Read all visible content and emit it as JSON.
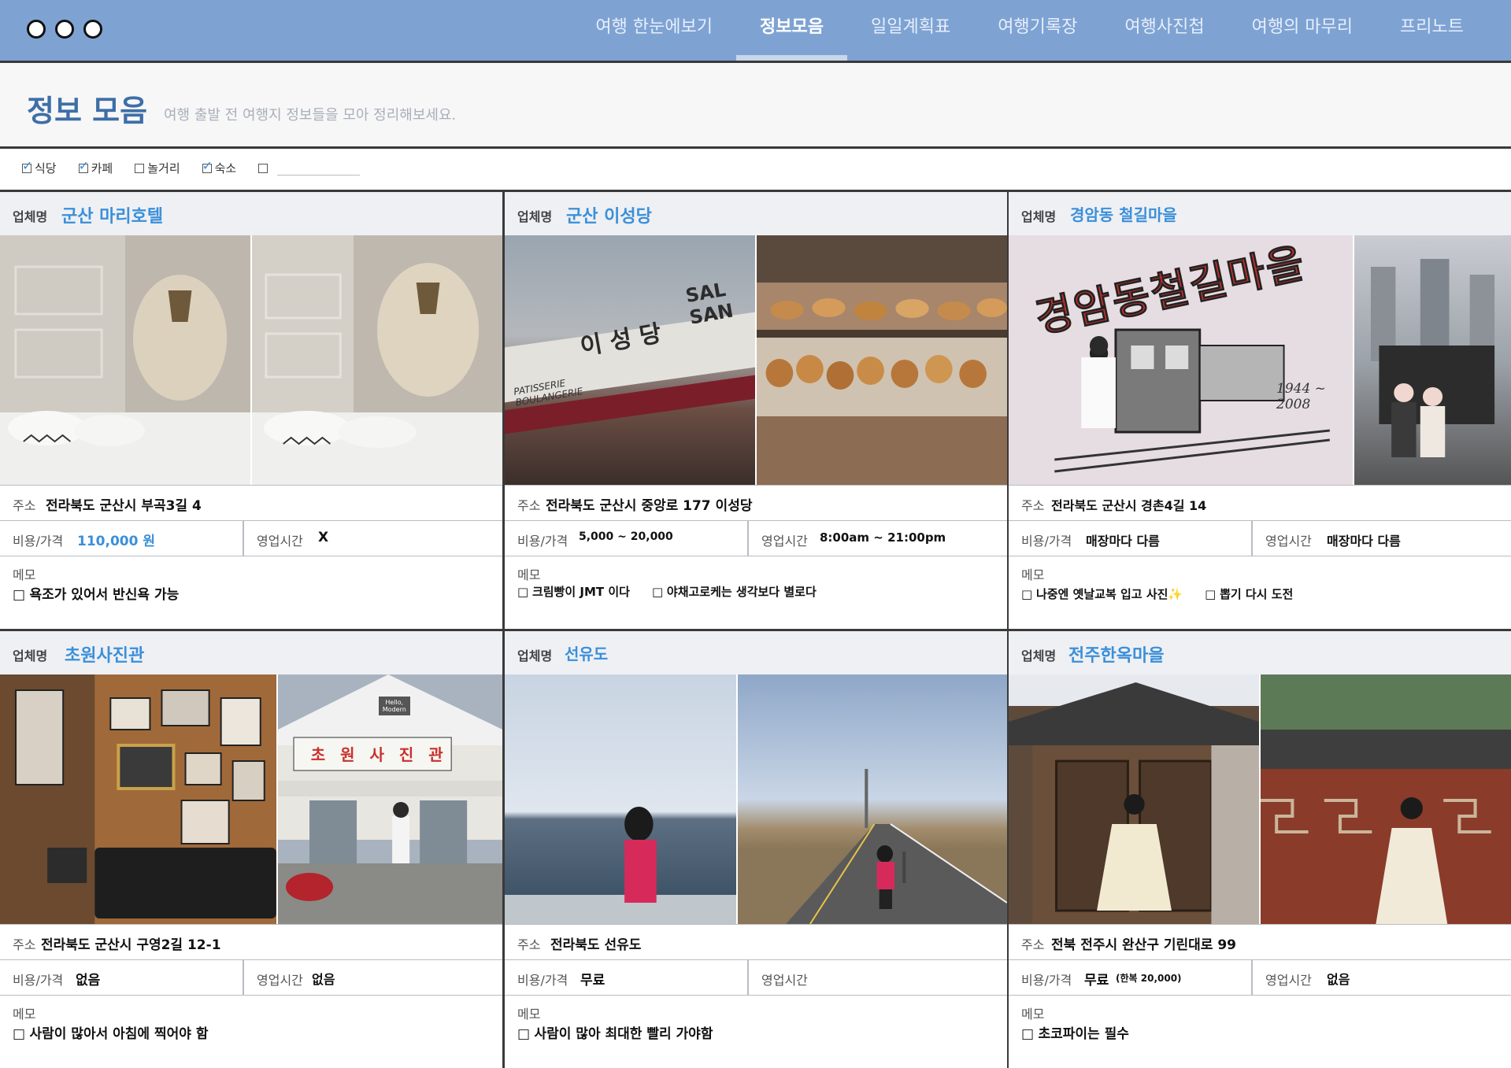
{
  "window": {
    "controls": [
      "circle",
      "circle",
      "circle"
    ]
  },
  "nav": {
    "items": [
      {
        "label": "여행 한눈에보기"
      },
      {
        "label": "정보모음",
        "active": true
      },
      {
        "label": "일일계획표"
      },
      {
        "label": "여행기록장"
      },
      {
        "label": "여행사진첩"
      },
      {
        "label": "여행의 마무리"
      },
      {
        "label": "프리노트"
      }
    ]
  },
  "header": {
    "title": "정보 모음",
    "subtitle": "여행 출발 전 여행지 정보들을 모아 정리해보세요."
  },
  "filters": [
    {
      "label": "식당",
      "checked": true
    },
    {
      "label": "카페",
      "checked": true
    },
    {
      "label": "놀거리",
      "checked": false
    },
    {
      "label": "숙소",
      "checked": true
    },
    {
      "label": "",
      "checked": false
    }
  ],
  "labels": {
    "name": "업체명",
    "address": "주소",
    "cost": "비용/가격",
    "hours": "영업시간",
    "memo": "메모"
  },
  "cards": [
    {
      "name": "군산 마리호텔",
      "address": "전라북도 군산시 부곡3길 4",
      "cost": "110,000 원",
      "cost_highlight": true,
      "hours": "X",
      "memos": [
        "욕조가 있어서 반신욕 가능"
      ]
    },
    {
      "name": "군산 이성당",
      "address": "전라북도 군산시 중앙로 177 이성당",
      "cost": "5,000 ~ 20,000",
      "hours": "8:00am ~ 21:00pm",
      "memos": [
        "크림빵이 JMT 이다",
        "야채고로케는 생각보다 별로다"
      ],
      "photo_text": {
        "sign": "이 성 당",
        "sign2": "SAL SAN",
        "sign3": "PATISSERIE BOULANGERIE"
      }
    },
    {
      "name": "경암동 철길마을",
      "address": "전라북도 군산시 경촌4길 14",
      "cost": "매장마다 다름",
      "hours": "매장마다 다름",
      "memos": [
        "나중엔 옛날교복 입고 사진✨",
        "뽑기 다시 도전"
      ],
      "photo_text": {
        "sign": "경암동철길마을",
        "years": "1944 ~ 2008"
      }
    },
    {
      "name": "초원사진관",
      "address": "전라북도 군산시 구영2길 12-1",
      "cost": "없음",
      "hours": "없음",
      "memos": [
        "사람이 많아서 아침에 찍어야 함"
      ],
      "photo_text": {
        "sign": "초 원 사 진 관",
        "badge": "Hello, Modern"
      }
    },
    {
      "name": "선유도",
      "address": "전라북도 선유도",
      "cost": "무료",
      "hours": "",
      "memos": [
        "사람이 많아 최대한 빨리 가야함"
      ]
    },
    {
      "name": "전주한옥마을",
      "address": "전북 전주시 완산구 기린대로 99",
      "cost": "무료",
      "cost_note": "(한복 20,000)",
      "hours": "없음",
      "memos": [
        "초코파이는 필수"
      ]
    }
  ],
  "colors": {
    "topbar": "#7ea3d3",
    "accent": "#3b8fd9",
    "title": "#3e6fa6",
    "border": "#3a3a3a"
  }
}
